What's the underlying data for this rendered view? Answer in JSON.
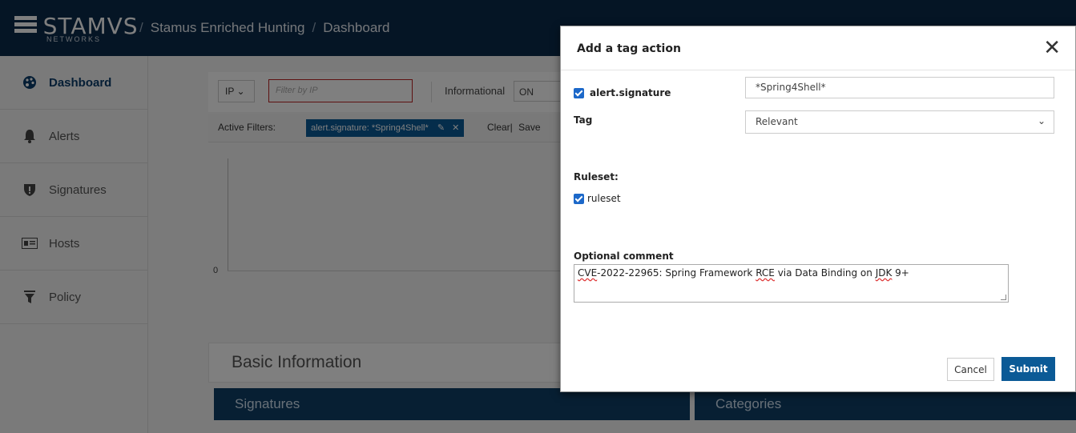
{
  "app": {
    "logo_text": "STAMVS",
    "logo_subtext": "NETWORKS",
    "breadcrumbs": [
      "Stamus Enriched Hunting",
      "Dashboard"
    ]
  },
  "sidebar": {
    "items": [
      {
        "label": "Dashboard",
        "icon": "palette-icon",
        "active": true
      },
      {
        "label": "Alerts",
        "icon": "bell-icon",
        "active": false
      },
      {
        "label": "Signatures",
        "icon": "shield-icon",
        "active": false
      },
      {
        "label": "Hosts",
        "icon": "id-card-icon",
        "active": false
      },
      {
        "label": "Policy",
        "icon": "funnel-icon",
        "active": false
      }
    ]
  },
  "filters": {
    "type_select": "IP ⌄",
    "ip_placeholder": "Filter by IP",
    "informational_label": "Informational",
    "informational_toggle": "ON",
    "active_label": "Active Filters:",
    "active_pill": "alert.signature: *Spring4Shell*",
    "clear_label": "Clear|",
    "save_label": "Save"
  },
  "chart": {
    "zero_label": "0"
  },
  "sections": {
    "basic_title": "Basic Information",
    "signatures_title": "Signatures",
    "categories_title": "Categories"
  },
  "modal": {
    "title": "Add a tag action",
    "close": "✕",
    "signature_label": "alert.signature",
    "signature_value": "*Spring4Shell*",
    "tag_label": "Tag",
    "tag_value": "Relevant",
    "ruleset_heading": "Ruleset:",
    "ruleset_label": "ruleset",
    "comment_label": "Optional comment",
    "comment_parts": [
      "CVE",
      "-2022-22965: Spring Framework ",
      "RCE",
      " via Data Binding on ",
      "JDK",
      " 9+"
    ],
    "cancel_label": "Cancel",
    "submit_label": "Submit"
  },
  "colors": {
    "topbar": "#0b2a4a",
    "primary": "#0b5a96",
    "checkbox": "#1c68c9",
    "panel_header": "#0f3e66"
  }
}
